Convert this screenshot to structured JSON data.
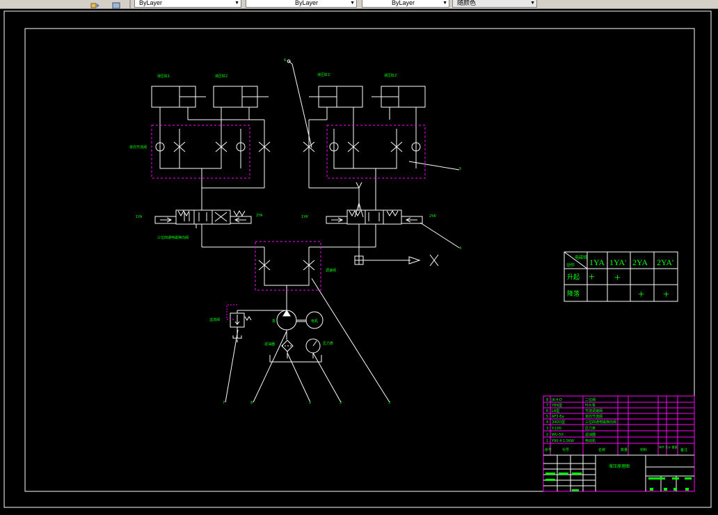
{
  "toolbar": {
    "linetype_combo": "ByLayer",
    "lineweight_combo": "ByLayer",
    "plotstyle_combo": "ByLayer",
    "color_combo": "随颜色"
  },
  "drawing": {
    "cylinder_labels": [
      "液压缸1",
      "液压缸2",
      "液压缸1'",
      "液压缸2'"
    ],
    "left_block_label": "单向节流阀",
    "valve_left_code_left": "1YA",
    "valve_left_code_right": "2YA",
    "valve_left_caption": "三位四通电磁换向阀",
    "valve_right_code_left": "1YA'",
    "valve_right_code_right": "2YA'",
    "center_block_label": "调速阀",
    "relief_label": "溢流阀",
    "pump_label": "泵",
    "motor_label": "电机",
    "filter_label": "滤油器",
    "gauge_label": "压力表",
    "balloon_numbers": [
      "1",
      "2",
      "3",
      "4",
      "5",
      "6",
      "7",
      "8",
      "9"
    ]
  },
  "solenoid_table": {
    "corner_top": "电磁铁",
    "corner_bottom": "动作",
    "headers": [
      "1YA",
      "1YA'",
      "2YA",
      "2YA'"
    ],
    "rows": [
      {
        "action": "升起",
        "cells": [
          "+",
          "+",
          "",
          ""
        ]
      },
      {
        "action": "降落",
        "cells": [
          "",
          "",
          "+",
          "+"
        ]
      }
    ]
  },
  "title_block": {
    "parts": [
      {
        "no": "8",
        "code": "JK-4-D",
        "name": "二位阀"
      },
      {
        "no": "7",
        "code": "YBN型",
        "name": "叶片泵"
      },
      {
        "no": "6",
        "code": "LA型",
        "name": "节流调速阀"
      },
      {
        "no": "5",
        "code": "AF3-Ea",
        "name": "单向节流阀"
      },
      {
        "no": "4",
        "code": "34DO型",
        "name": "三位四通电磁换向阀"
      },
      {
        "no": "3",
        "code": "Y-100",
        "name": "压力表"
      },
      {
        "no": "2",
        "code": "WU-50",
        "name": "滤油器"
      },
      {
        "no": "1",
        "code": "Y90-4 1.5KW",
        "name": "电动机"
      }
    ],
    "header": {
      "no": "序号",
      "code": "代号",
      "name": "名称",
      "qty": "数量",
      "material": "材料",
      "weight": "单件 总计 重量",
      "note": "备注"
    },
    "drawing_name": "液压原理图"
  },
  "colors": {
    "background": "#000000",
    "line": "#ffffff",
    "text": "#00ff00",
    "magenta": "#ff00ff"
  }
}
